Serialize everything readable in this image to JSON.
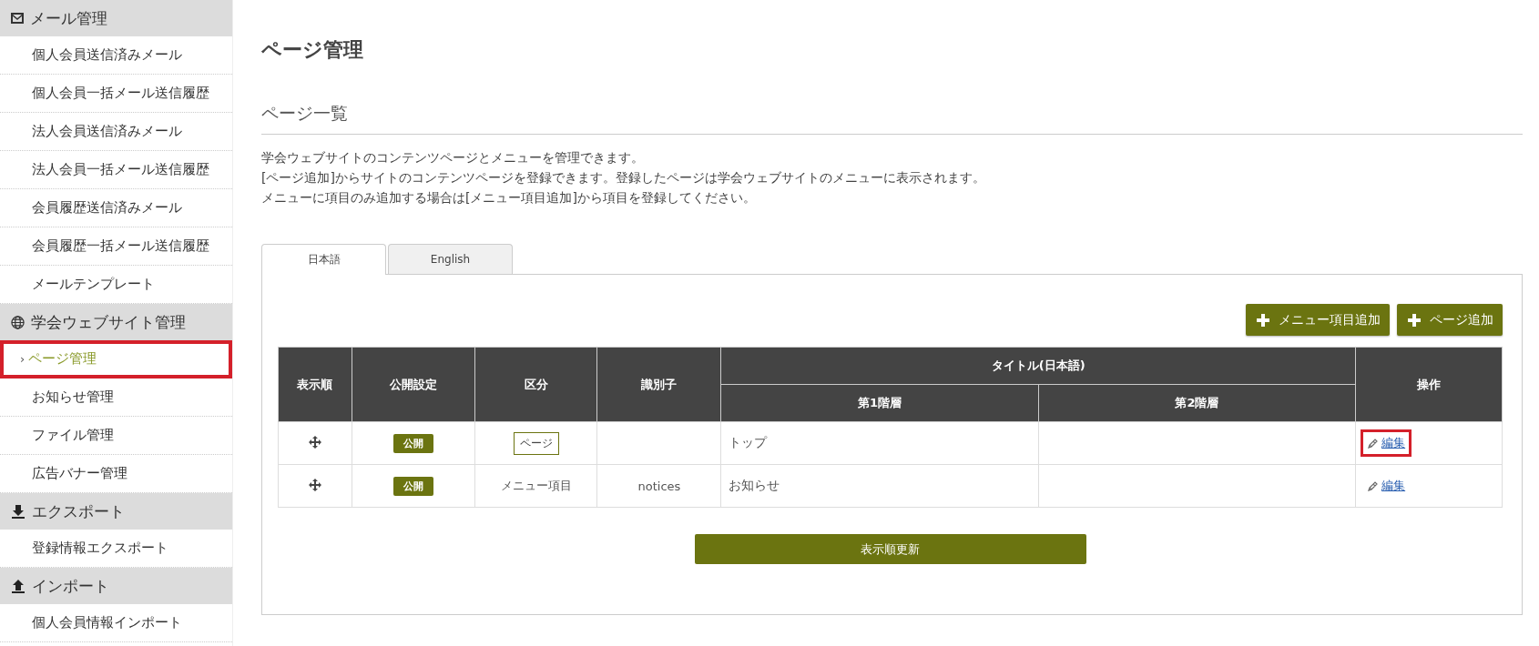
{
  "sidebar": {
    "sections": [
      {
        "label": "メール管理",
        "items": [
          {
            "label": "個人会員送信済みメール",
            "selected": false,
            "highlighted": false
          },
          {
            "label": "個人会員一括メール送信履歴",
            "selected": false,
            "highlighted": false
          },
          {
            "label": "法人会員送信済みメール",
            "selected": false,
            "highlighted": false
          },
          {
            "label": "法人会員一括メール送信履歴",
            "selected": false,
            "highlighted": false
          },
          {
            "label": "会員履歴送信済みメール",
            "selected": false,
            "highlighted": false
          },
          {
            "label": "会員履歴一括メール送信履歴",
            "selected": false,
            "highlighted": false
          },
          {
            "label": "メールテンプレート",
            "selected": false,
            "highlighted": false
          }
        ]
      },
      {
        "label": "学会ウェブサイト管理",
        "items": [
          {
            "label": "ページ管理",
            "marker": "›",
            "selected": true,
            "highlighted": true
          },
          {
            "label": "お知らせ管理",
            "selected": false,
            "highlighted": false
          },
          {
            "label": "ファイル管理",
            "selected": false,
            "highlighted": false
          },
          {
            "label": "広告バナー管理",
            "selected": false,
            "highlighted": false
          }
        ]
      },
      {
        "label": "エクスポート",
        "items": [
          {
            "label": "登録情報エクスポート",
            "selected": false,
            "highlighted": false
          }
        ]
      },
      {
        "label": "インポート",
        "items": [
          {
            "label": "個人会員情報インポート",
            "selected": false,
            "highlighted": false
          }
        ]
      }
    ]
  },
  "page_title": "ページ管理",
  "section_title": "ページ一覧",
  "description": [
    "学会ウェブサイトのコンテンツページとメニューを管理できます。",
    "[ページ追加]からサイトのコンテンツページを登録できます。登録したページは学会ウェブサイトのメニューに表示されます。",
    "メニューに項目のみ追加する場合は[メニュー項目追加]から項目を登録してください。"
  ],
  "tabs": [
    {
      "label": "日本語",
      "selected": true
    },
    {
      "label": "English",
      "selected": false
    }
  ],
  "buttons": [
    "メニュー項目追加",
    "ページ追加"
  ],
  "table": {
    "columns": [
      "表示順",
      "公開設定",
      "区分",
      "識別子"
    ],
    "title_group": "タイトル(日本語)",
    "title_columns": [
      "第1階層",
      "第2階層"
    ],
    "actions_column": "操作",
    "rows": [
      {
        "status": "公開",
        "category": "ページ",
        "kind": "tag",
        "identifier": "",
        "level1": "トップ",
        "level2": "",
        "action": "編集",
        "highlighted": true
      },
      {
        "status": "公開",
        "category": "メニュー項目",
        "kind": "text",
        "identifier": "notices",
        "level1": "お知らせ",
        "level2": "",
        "action": "編集",
        "highlighted": false
      }
    ]
  },
  "update_button": "表示順更新"
}
